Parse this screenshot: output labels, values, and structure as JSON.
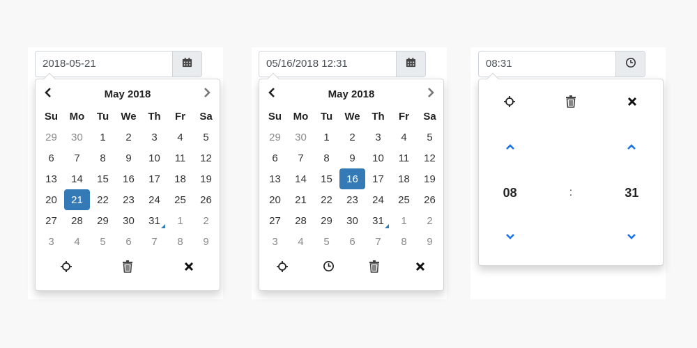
{
  "colors": {
    "accent": "#337ab7",
    "chevron_blue": "#1a73e8"
  },
  "picker1": {
    "input_value": "2018-05-21",
    "addon_icon": "calendar-icon",
    "month_title": "May 2018",
    "weekdays": [
      "Su",
      "Mo",
      "Tu",
      "We",
      "Th",
      "Fr",
      "Sa"
    ],
    "weeks": [
      [
        "29",
        "30",
        "1",
        "2",
        "3",
        "4",
        "5"
      ],
      [
        "6",
        "7",
        "8",
        "9",
        "10",
        "11",
        "12"
      ],
      [
        "13",
        "14",
        "15",
        "16",
        "17",
        "18",
        "19"
      ],
      [
        "20",
        "21",
        "22",
        "23",
        "24",
        "25",
        "26"
      ],
      [
        "27",
        "28",
        "29",
        "30",
        "31",
        "1",
        "2"
      ],
      [
        "3",
        "4",
        "5",
        "6",
        "7",
        "8",
        "9"
      ]
    ],
    "selected_day": "21",
    "today_day": "31",
    "actions": [
      "crosshair-icon",
      "trash-icon",
      "close-icon"
    ]
  },
  "picker2": {
    "input_value": "05/16/2018 12:31",
    "addon_icon": "calendar-icon",
    "month_title": "May 2018",
    "weekdays": [
      "Su",
      "Mo",
      "Tu",
      "We",
      "Th",
      "Fr",
      "Sa"
    ],
    "weeks": [
      [
        "29",
        "30",
        "1",
        "2",
        "3",
        "4",
        "5"
      ],
      [
        "6",
        "7",
        "8",
        "9",
        "10",
        "11",
        "12"
      ],
      [
        "13",
        "14",
        "15",
        "16",
        "17",
        "18",
        "19"
      ],
      [
        "20",
        "21",
        "22",
        "23",
        "24",
        "25",
        "26"
      ],
      [
        "27",
        "28",
        "29",
        "30",
        "31",
        "1",
        "2"
      ],
      [
        "3",
        "4",
        "5",
        "6",
        "7",
        "8",
        "9"
      ]
    ],
    "selected_day": "16",
    "today_day": "31",
    "actions": [
      "crosshair-icon",
      "clock-icon",
      "trash-icon",
      "close-icon"
    ]
  },
  "picker3": {
    "input_value": "08:31",
    "addon_icon": "clock-icon",
    "hour": "08",
    "separator": ":",
    "minute": "31",
    "actions": [
      "crosshair-icon",
      "trash-icon",
      "close-icon"
    ]
  }
}
